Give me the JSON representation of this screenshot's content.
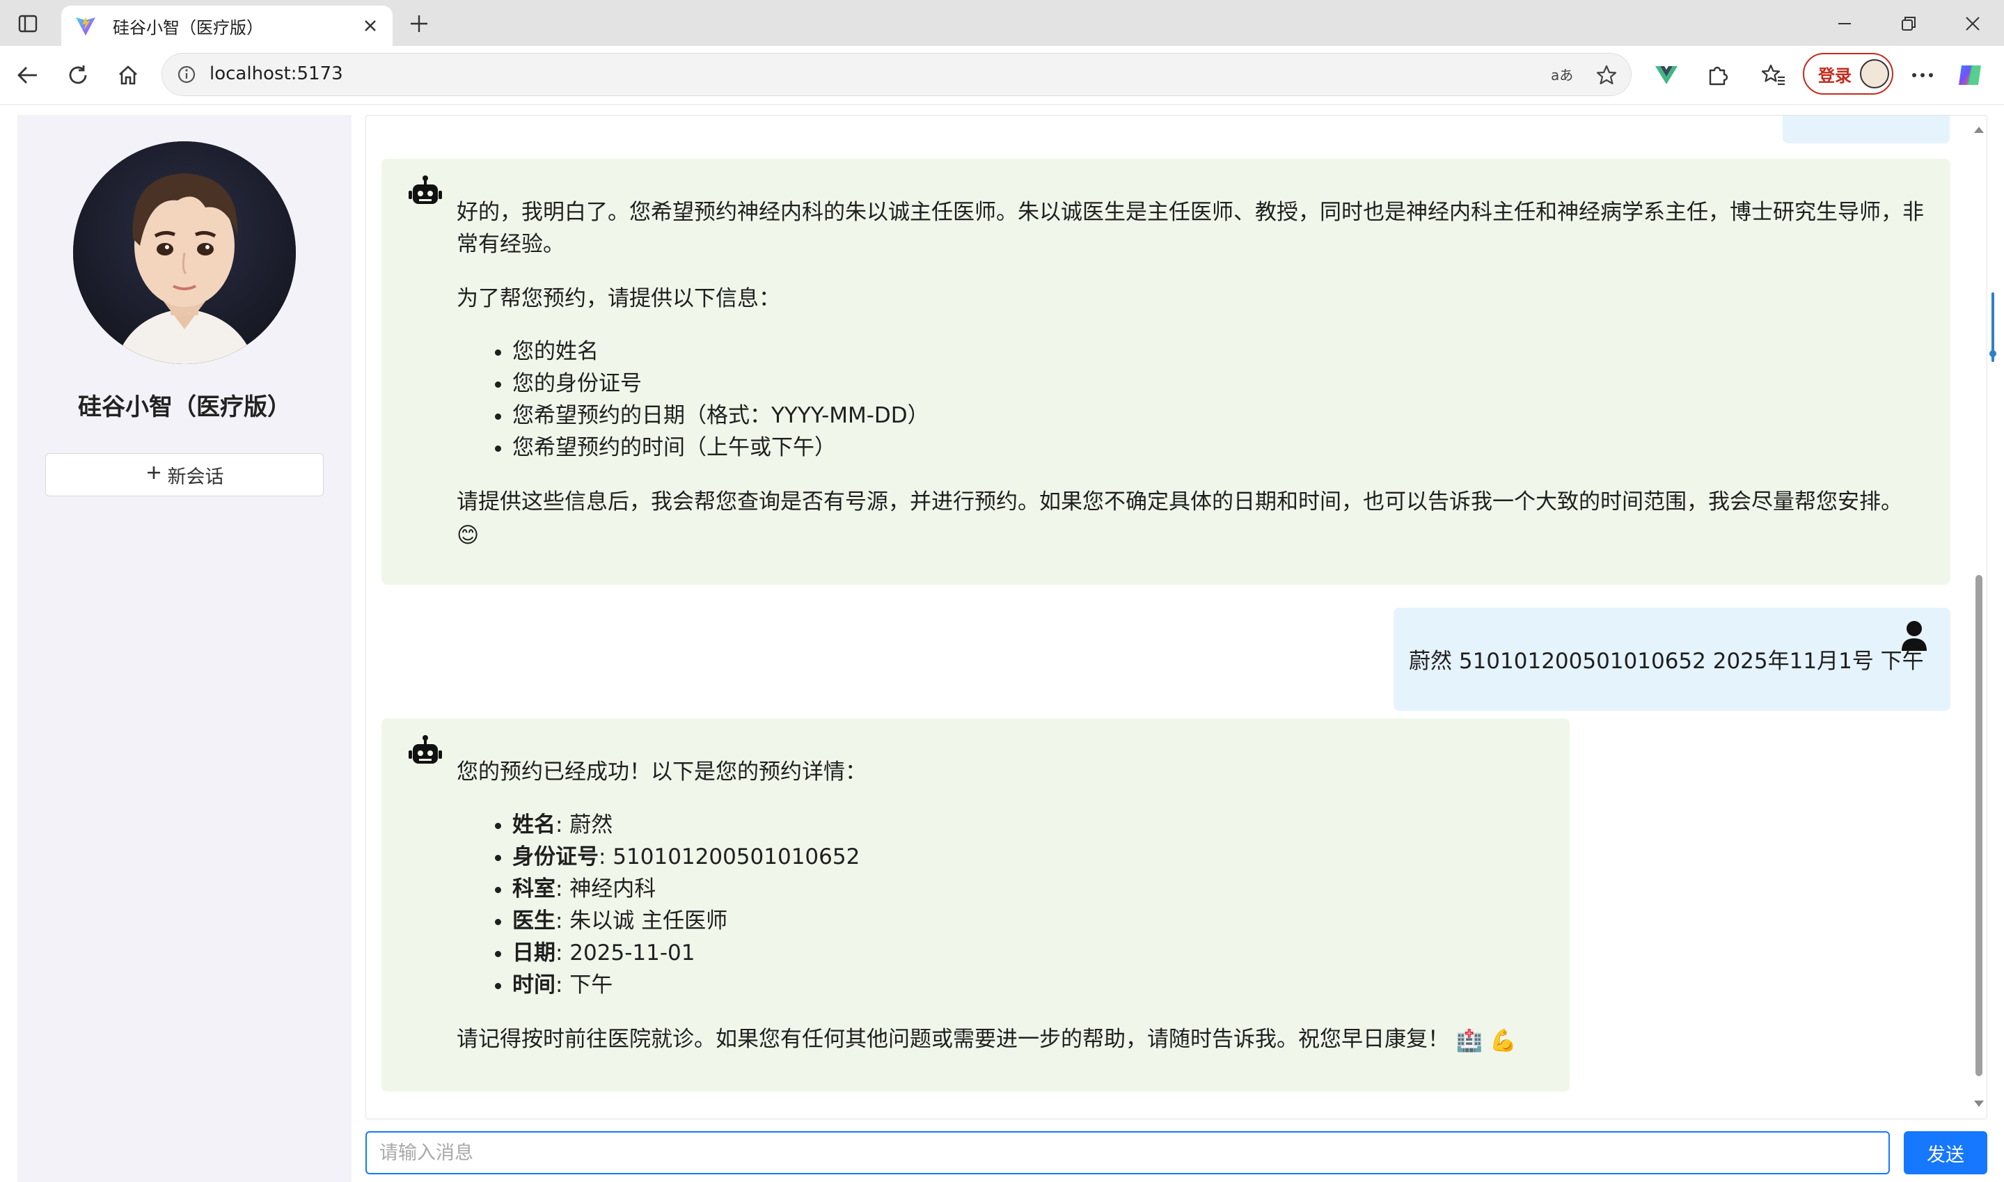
{
  "browser": {
    "tab_title": "硅谷小智（医疗版）",
    "url": "localhost:5173",
    "login_label": "登录"
  },
  "sidebar": {
    "app_title": "硅谷小智（医疗版）",
    "new_chat_label": "新会话"
  },
  "messages": {
    "bot1": {
      "p1": "好的，我明白了。您希望预约神经内科的朱以诚主任医师。朱以诚医生是主任医师、教授，同时也是神经内科主任和神经病学系主任，博士研究生导师，非常有经验。",
      "p2": "为了帮您预约，请提供以下信息：",
      "items": [
        "您的姓名",
        "您的身份证号",
        "您希望预约的日期（格式：YYYY-MM-DD）",
        "您希望预约的时间（上午或下午）"
      ],
      "p3": "请提供这些信息后，我会帮您查询是否有号源，并进行预约。如果您不确定具体的日期和时间，也可以告诉我一个大致的时间范围，我会尽量帮您安排。",
      "emoji": "😊"
    },
    "user1": {
      "text": "蔚然 510101200501010652 2025年11月1号 下午"
    },
    "bot2": {
      "p1": "您的预约已经成功！以下是您的预约详情：",
      "details": [
        {
          "label": "姓名",
          "value": ": 蔚然"
        },
        {
          "label": "身份证号",
          "value": ": 510101200501010652"
        },
        {
          "label": "科室",
          "value": ": 神经内科"
        },
        {
          "label": "医生",
          "value": ": 朱以诚 主任医师"
        },
        {
          "label": "日期",
          "value": ": 2025-11-01"
        },
        {
          "label": "时间",
          "value": ": 下午"
        }
      ],
      "p2": "请记得按时前往医院就诊。如果您有任何其他问题或需要进一步的帮助，请随时告诉我。祝您早日康复！",
      "emoji1": "🏥",
      "emoji2": "💪"
    }
  },
  "input": {
    "placeholder": "请输入消息",
    "value": ""
  },
  "send_label": "发送",
  "colors": {
    "accent": "#1677ff",
    "bot_bubble": "#f0f7ea",
    "user_bubble": "#e5f3fd",
    "sidebar_bg": "#f3f2f8",
    "login_red": "#c42b1c"
  }
}
